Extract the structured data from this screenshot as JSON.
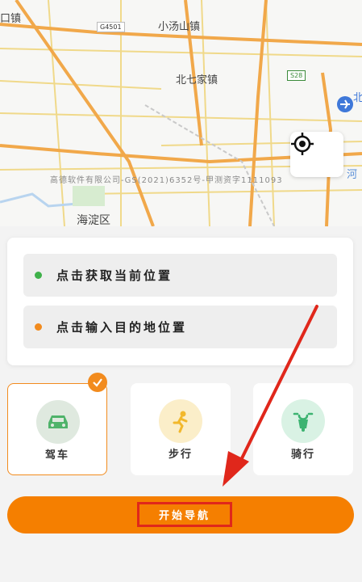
{
  "map": {
    "labels": {
      "town_left": "口镇",
      "xiaotangshan": "小汤山镇",
      "beiqijia": "北七家镇",
      "haidian": "海淀区",
      "right_top": "北",
      "right_mid": "河"
    },
    "road_badges": {
      "g4501": "G4501",
      "s28": "S28"
    },
    "copyright": "高德软件有限公司-GS(2021)6352号-甲测资字1111093",
    "locate_icon": "crosshair-icon",
    "airport_icon": "airport-icon"
  },
  "locations": {
    "current": "点击获取当前位置",
    "destination": "点击输入目的地位置",
    "current_dot_color": "#3fb14a",
    "destination_dot_color": "#f28b1e"
  },
  "modes": [
    {
      "label": "驾车",
      "icon": "car-icon",
      "selected": true
    },
    {
      "label": "步行",
      "icon": "walk-icon",
      "selected": false
    },
    {
      "label": "骑行",
      "icon": "scooter-icon",
      "selected": false
    }
  ],
  "start_button": {
    "label": "开始导航"
  },
  "colors": {
    "accent": "#f57f00",
    "highlight_box": "#e0271b",
    "annotation_arrow": "#e0271b"
  }
}
